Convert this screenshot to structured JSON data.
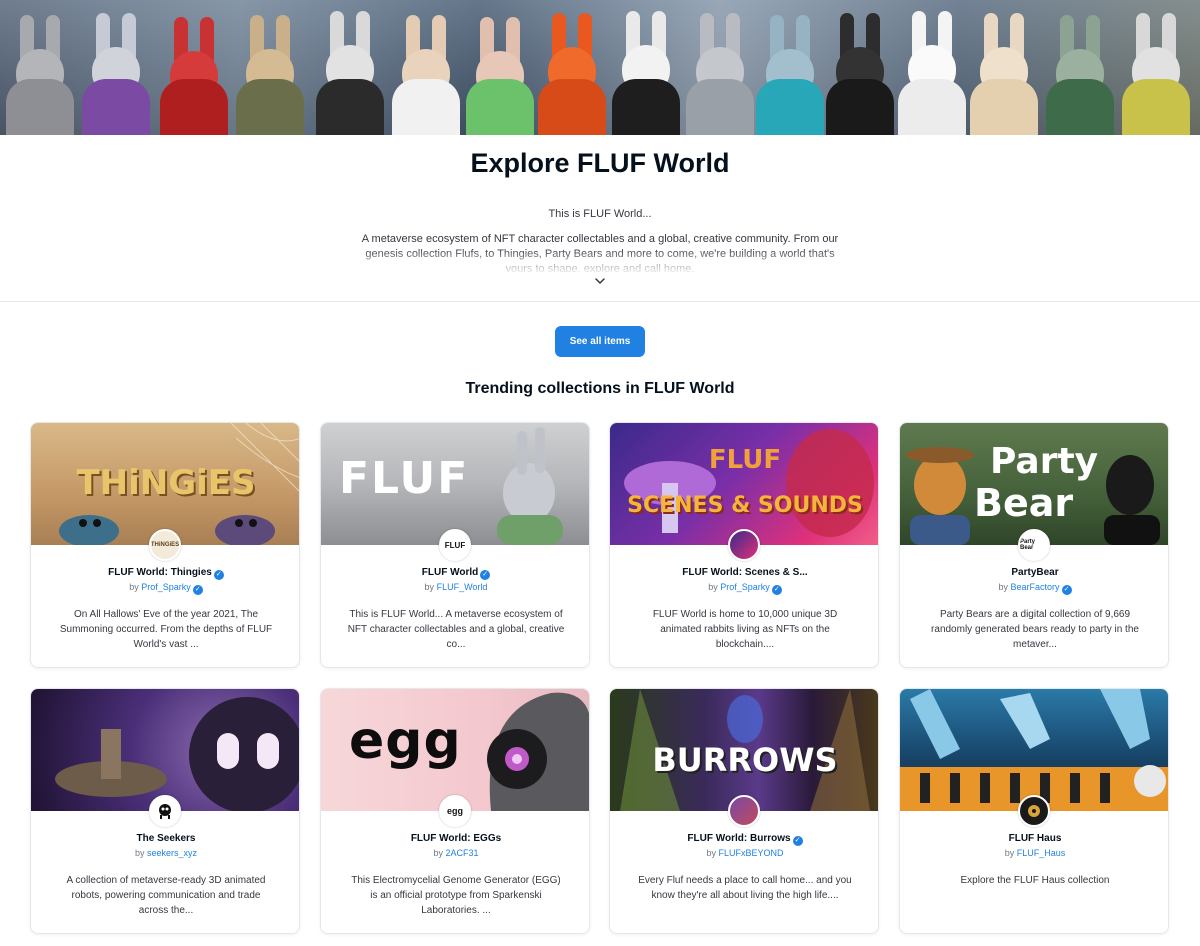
{
  "page": {
    "title": "Explore FLUF World",
    "intro_short": "This is FLUF World...",
    "intro_long": "A metaverse ecosystem of NFT character collectables and a global, creative community. From our genesis collection Flufs, to Thingies, Party Bears and more to come, we're building a world that's yours to shape, explore and call home.",
    "see_all_label": "See all items",
    "section_title": "Trending collections in FLUF World"
  },
  "colors": {
    "accent": "#2081e2",
    "text": "#04111d",
    "muted": "#707a83",
    "border": "#e5e8eb"
  },
  "icons": {
    "expand": "chevron-down-icon",
    "verified": "verified-badge-icon"
  },
  "collections": [
    {
      "name": "FLUF World: Thingies",
      "by_label": "by",
      "creator": "Prof_Sparky",
      "name_verified": true,
      "creator_verified": true,
      "description": "On All Hallows' Eve of the year 2021, The Summoning occurred. From the depths of FLUF World's vast ...",
      "cover_text": "THiNGiES",
      "avatar_text": "THiNGiES"
    },
    {
      "name": "FLUF World",
      "by_label": "by",
      "creator": "FLUF_World",
      "name_verified": true,
      "creator_verified": false,
      "description": "This is FLUF World... A metaverse ecosystem of NFT character collectables and a global, creative co...",
      "cover_text": "FLUF",
      "avatar_text": "FLUF"
    },
    {
      "name": "FLUF World: Scenes & S...",
      "by_label": "by",
      "creator": "Prof_Sparky",
      "name_verified": false,
      "creator_verified": true,
      "description": "FLUF World is home to 10,000 unique 3D animated rabbits living as NFTs on the blockchain....",
      "cover_text": "SCENES & SOUNDS",
      "cover_text_top": "FLUF",
      "avatar_text": ""
    },
    {
      "name": "PartyBear",
      "by_label": "by",
      "creator": "BearFactory",
      "name_verified": false,
      "creator_verified": true,
      "description": "Party Bears are a digital collection of 9,669 randomly generated bears ready to party in the metaver...",
      "cover_text": "Party",
      "cover_text_2": "Bear",
      "avatar_text": "Party Bear"
    },
    {
      "name": "The Seekers",
      "by_label": "by",
      "creator": "seekers_xyz",
      "name_verified": false,
      "creator_verified": false,
      "description": "A collection of metaverse-ready 3D animated robots, powering communication and trade across the...",
      "cover_text": "",
      "avatar_text": ""
    },
    {
      "name": "FLUF World: EGGs",
      "by_label": "by",
      "creator": "2ACF31",
      "name_verified": false,
      "creator_verified": false,
      "description": "This Electromycelial Genome Generator (EGG) is an official prototype from Sparkenski Laboratories. ...",
      "cover_text": "egg",
      "avatar_text": "egg"
    },
    {
      "name": "FLUF World: Burrows",
      "by_label": "by",
      "creator": "FLUFxBEYOND",
      "name_verified": true,
      "creator_verified": false,
      "description": "Every Fluf needs a place to call home... and you know they're all about living the high life....",
      "cover_text": "BURROWS",
      "avatar_text": ""
    },
    {
      "name": "FLUF Haus",
      "by_label": "by",
      "creator": "FLUF_Haus",
      "name_verified": false,
      "creator_verified": false,
      "description": "Explore the FLUF Haus collection",
      "cover_text": "",
      "avatar_text": ""
    }
  ]
}
